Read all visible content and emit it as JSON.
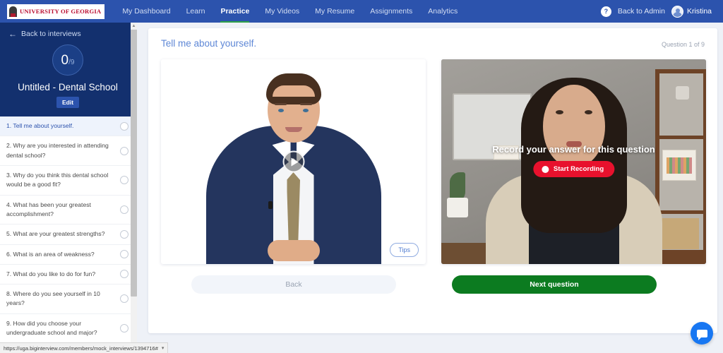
{
  "topnav": {
    "logo_text": "UNIVERSITY OF GEORGIA",
    "logo_icon": "uga-arch-icon",
    "items": [
      {
        "label": "My Dashboard",
        "active": false
      },
      {
        "label": "Learn",
        "active": false
      },
      {
        "label": "Practice",
        "active": true
      },
      {
        "label": "My Videos",
        "active": false
      },
      {
        "label": "My Resume",
        "active": false
      },
      {
        "label": "Assignments",
        "active": false
      },
      {
        "label": "Analytics",
        "active": false
      }
    ],
    "help_icon": "question-mark-icon",
    "help_label": "?",
    "back_to_admin": "Back to Admin",
    "user_name": "Kristina",
    "avatar_icon": "user-avatar-icon",
    "accent_color": "#2c53ad",
    "active_underline_color": "#2ea04a"
  },
  "sidebar": {
    "back_link": "Back to interviews",
    "back_arrow_icon": "arrow-left-icon",
    "score_completed": "0",
    "score_total": "/9",
    "interview_title": "Untitled - Dental School",
    "edit_label": "Edit",
    "header_color": "#13306e",
    "questions": [
      {
        "label": "1. Tell me about yourself.",
        "active": true
      },
      {
        "label": "2. Why are you interested in attending dental school?",
        "active": false
      },
      {
        "label": "3. Why do you think this dental school would be a good fit?",
        "active": false
      },
      {
        "label": "4. What has been your greatest accomplishment?",
        "active": false
      },
      {
        "label": "5. What are your greatest strengths?",
        "active": false
      },
      {
        "label": "6. What is an area of weakness?",
        "active": false
      },
      {
        "label": "7. What do you like to do for fun?",
        "active": false
      },
      {
        "label": "8. Where do you see yourself in 10 years?",
        "active": false
      },
      {
        "label": "9. How did you choose your undergraduate school and major?",
        "active": false
      }
    ],
    "scroll_up_arrow": "▲"
  },
  "main": {
    "question_title": "Tell me about yourself.",
    "question_counter": "Question 1 of 9",
    "coach_video": {
      "play_icon": "play-triangle-icon",
      "tips_label": "Tips"
    },
    "webcam": {
      "overlay_text": "Record your answer for this question",
      "record_label": "Start Recording",
      "record_dot_icon": "record-dot-icon",
      "record_color": "#e8112d"
    },
    "back_label": "Back",
    "next_label": "Next question",
    "next_color": "#0c7b20"
  },
  "chat": {
    "icon": "chat-bubble-icon",
    "color": "#1877f2"
  },
  "statusbar": {
    "url": "https://uga.biginterview.com/members/mock_interviews/1394716#",
    "caret": "▾"
  }
}
